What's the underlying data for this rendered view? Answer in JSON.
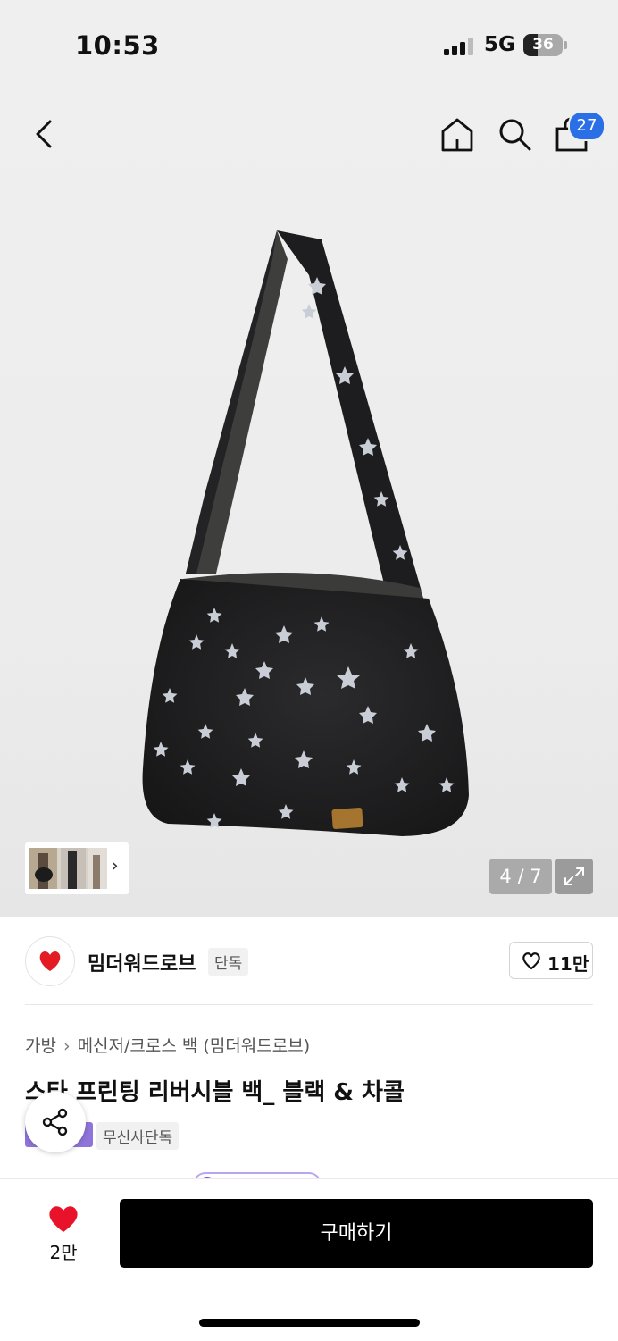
{
  "status_bar": {
    "time": "10:53",
    "network": "5G",
    "battery": "36",
    "battery_level": 0.36
  },
  "header": {
    "back_icon": "chevron-left-icon",
    "home_icon": "home-icon",
    "search_icon": "search-icon",
    "cart_icon": "shopping-bag-icon",
    "cart_count": "27",
    "badge_color": "#2a6fe6"
  },
  "gallery": {
    "counter": "4 / 7",
    "expand_icon": "expand-icon",
    "thumb_arrow": "›"
  },
  "brand": {
    "name": "밈더워드로브",
    "tag": "단독",
    "like_icon": "heart-outline-icon",
    "like_count": "11만"
  },
  "product": {
    "breadcrumb": [
      "가방",
      "메신저/크로스 백 (밈더워드로브)"
    ],
    "title": "스타 프린팅 리버시블 백_ 블랙 & 차콜",
    "exclusive_tag": "무신사단독",
    "share_icon": "share-icon"
  },
  "bottom_bar": {
    "favorite_icon": "heart-filled-icon",
    "favorite_count": "2만",
    "buy_label": "구매하기",
    "heart_color": "#e8132b"
  }
}
